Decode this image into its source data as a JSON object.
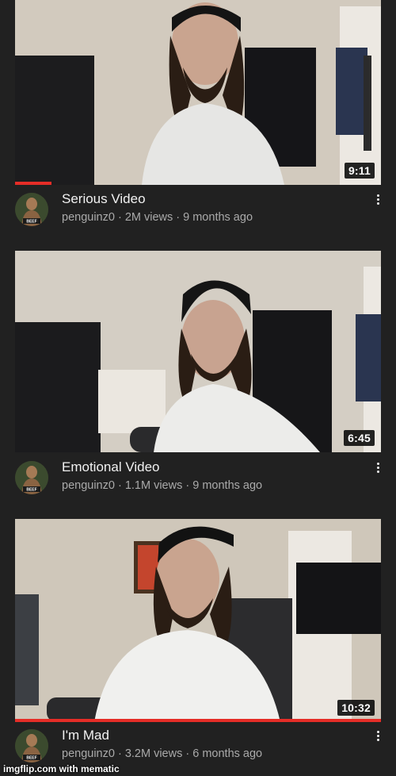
{
  "videos": [
    {
      "title": "Serious Video",
      "channel": "penguinz0",
      "views": "2M views",
      "age": "9 months ago",
      "duration": "9:11",
      "watched_fraction": 0.1,
      "avatar_caption": "BEEF"
    },
    {
      "title": "Emotional Video",
      "channel": "penguinz0",
      "views": "1.1M views",
      "age": "9 months ago",
      "duration": "6:45",
      "watched_fraction": 0,
      "avatar_caption": "BEEF"
    },
    {
      "title": "I'm Mad",
      "channel": "penguinz0",
      "views": "3.2M views",
      "age": "6 months ago",
      "duration": "10:32",
      "watched_fraction": 1.0,
      "avatar_caption": "BEEF"
    }
  ],
  "separator": " · ",
  "watermark": "imgflip.com with mematic",
  "colors": {
    "background": "#212121",
    "progress": "#e52d27",
    "secondary_text": "#aaaaaa"
  },
  "icons": {
    "more": "more-vert-icon"
  }
}
